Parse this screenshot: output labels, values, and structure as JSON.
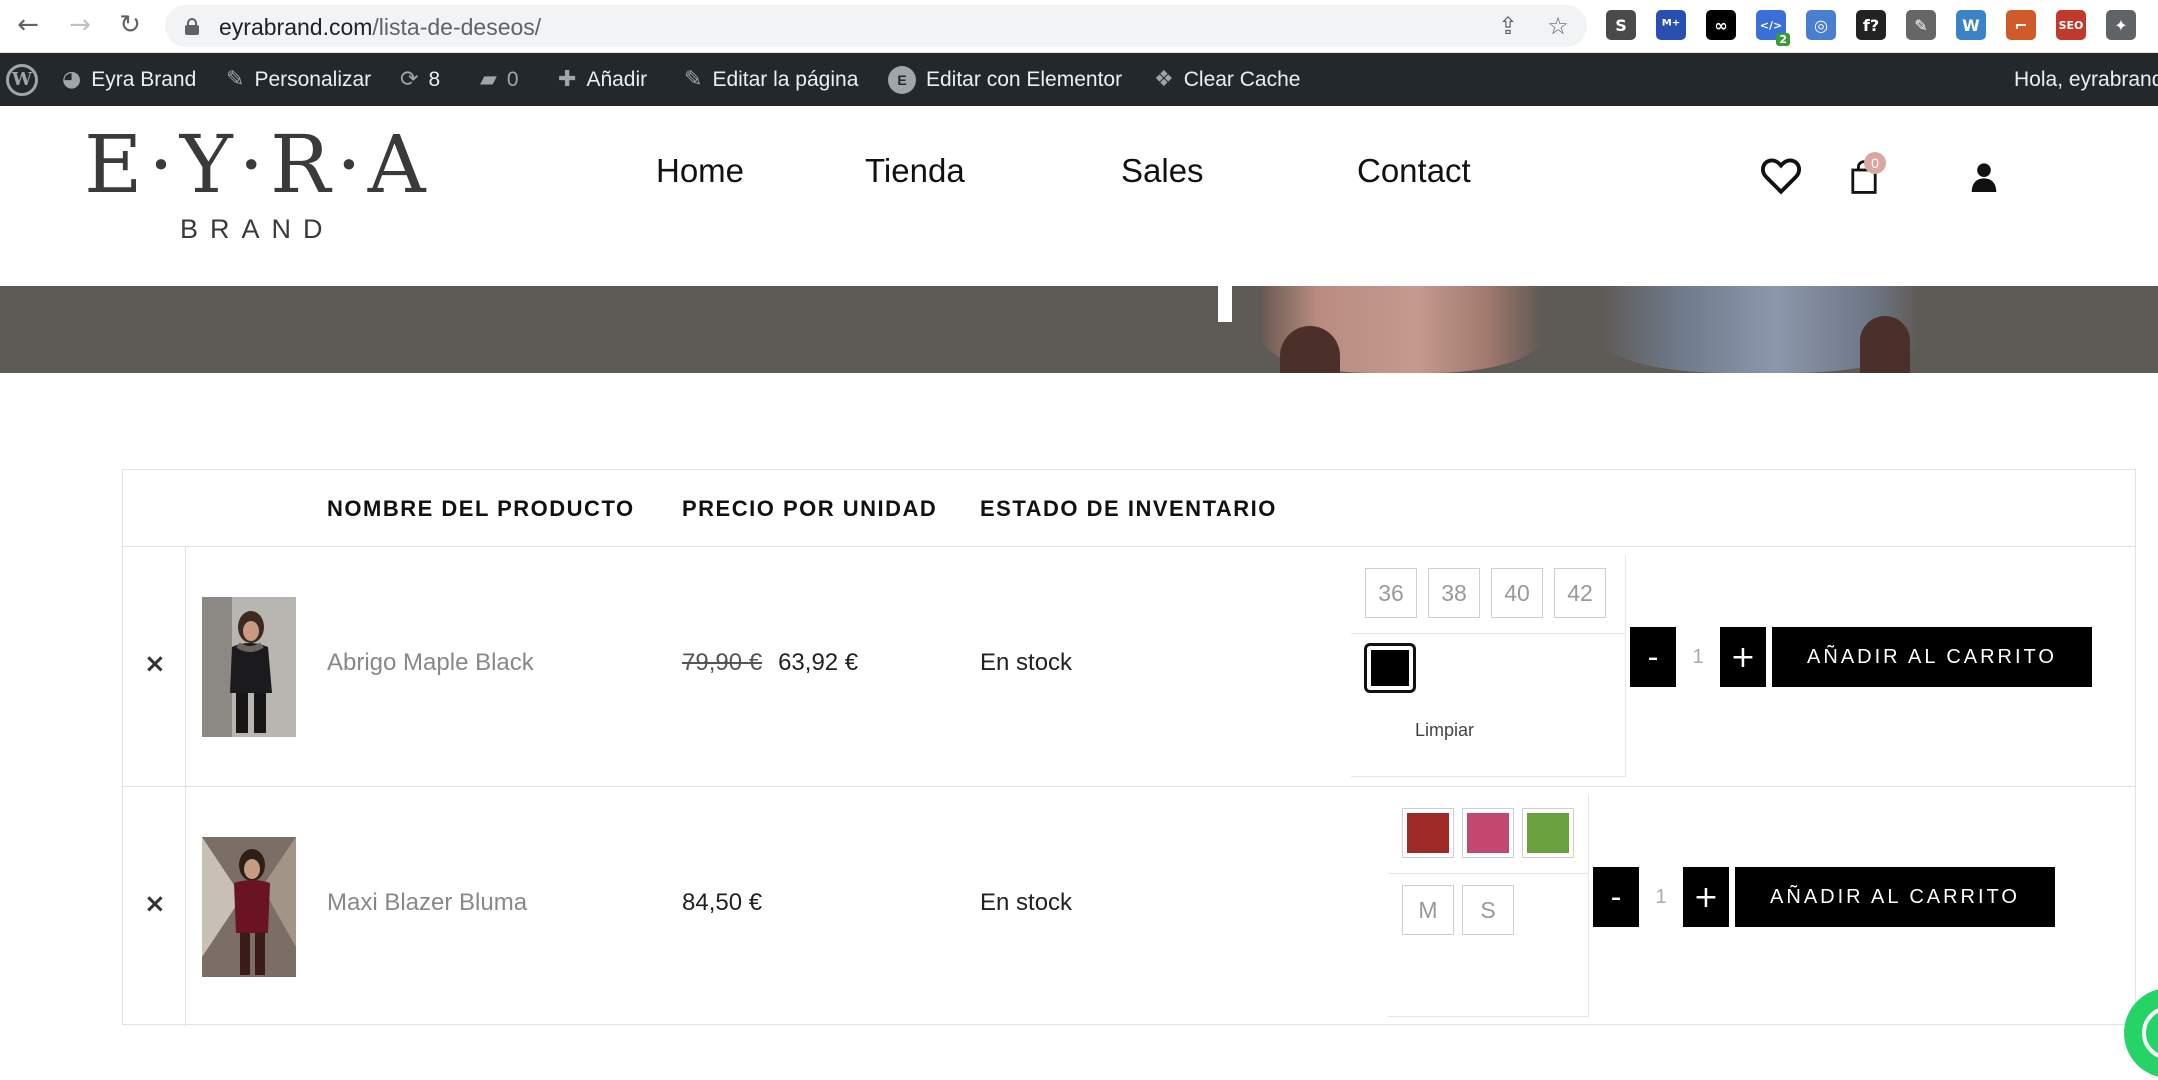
{
  "browser": {
    "url_host": "eyrabrand.com",
    "url_path": "/lista-de-deseos/",
    "extensions": [
      {
        "name": "s-extension-icon",
        "label": "S",
        "color": "#4a4a4a"
      },
      {
        "name": "m-extension-icon",
        "label": "ᴹ⁺",
        "color": "#2a4fb0"
      },
      {
        "name": "infinity-extension-icon",
        "label": "∞",
        "color": "#000000"
      },
      {
        "name": "code-extension-icon",
        "label": "</>",
        "color": "#3b6fd8",
        "badge": "2"
      },
      {
        "name": "spiral-extension-icon",
        "label": "◎",
        "color": "#4a7fd0"
      },
      {
        "name": "font-extension-icon",
        "label": "f?",
        "color": "#222222"
      },
      {
        "name": "dropper-extension-icon",
        "label": "✎",
        "color": "#666666"
      },
      {
        "name": "wordpress-extension-icon",
        "label": "W",
        "color": "#3b83c7"
      },
      {
        "name": "ruler-extension-icon",
        "label": "⌐",
        "color": "#d05a2a"
      },
      {
        "name": "seo-extension-icon",
        "label": "SEO",
        "color": "#c0392b"
      },
      {
        "name": "puzzle-extension-icon",
        "label": "✦",
        "color": "#5f6368"
      }
    ]
  },
  "admin_bar": {
    "site_name": "Eyra Brand",
    "customize": "Personalizar",
    "updates_count": "8",
    "comments_count": "0",
    "add_new": "Añadir",
    "edit_page": "Editar la página",
    "edit_elementor": "Editar con Elementor",
    "clear_cache": "Clear Cache",
    "greeting": "Hola, eyrabrand"
  },
  "header": {
    "logo_main": "E·Y·R·A",
    "logo_sub": "BRAND",
    "menu": [
      "Home",
      "Tienda",
      "Sales",
      "Contact"
    ],
    "cart_count": "0"
  },
  "wishlist": {
    "columns": [
      "NOMBRE DEL PRODUCTO",
      "PRECIO POR UNIDAD",
      "ESTADO DE INVENTARIO"
    ],
    "items": [
      {
        "name": "Abrigo Maple Black",
        "old_price": "79,90 €",
        "price": "63,92 €",
        "stock": "En stock",
        "sizes": [
          "36",
          "38",
          "40",
          "42"
        ],
        "colors": [
          "#000000"
        ],
        "clear_label": "Limpiar",
        "quantity": "1",
        "add_to_cart": "AÑADIR AL CARRITO"
      },
      {
        "name": "Maxi Blazer Bluma",
        "old_price": "",
        "price": "84,50 €",
        "stock": "En stock",
        "sizes": [
          "M",
          "S"
        ],
        "colors": [
          "#a02a28",
          "#c24870",
          "#6aa13e"
        ],
        "quantity": "1",
        "add_to_cart": "AÑADIR AL CARRITO"
      }
    ],
    "qty_minus": "-",
    "qty_plus": "+",
    "remove_symbol": "×"
  }
}
